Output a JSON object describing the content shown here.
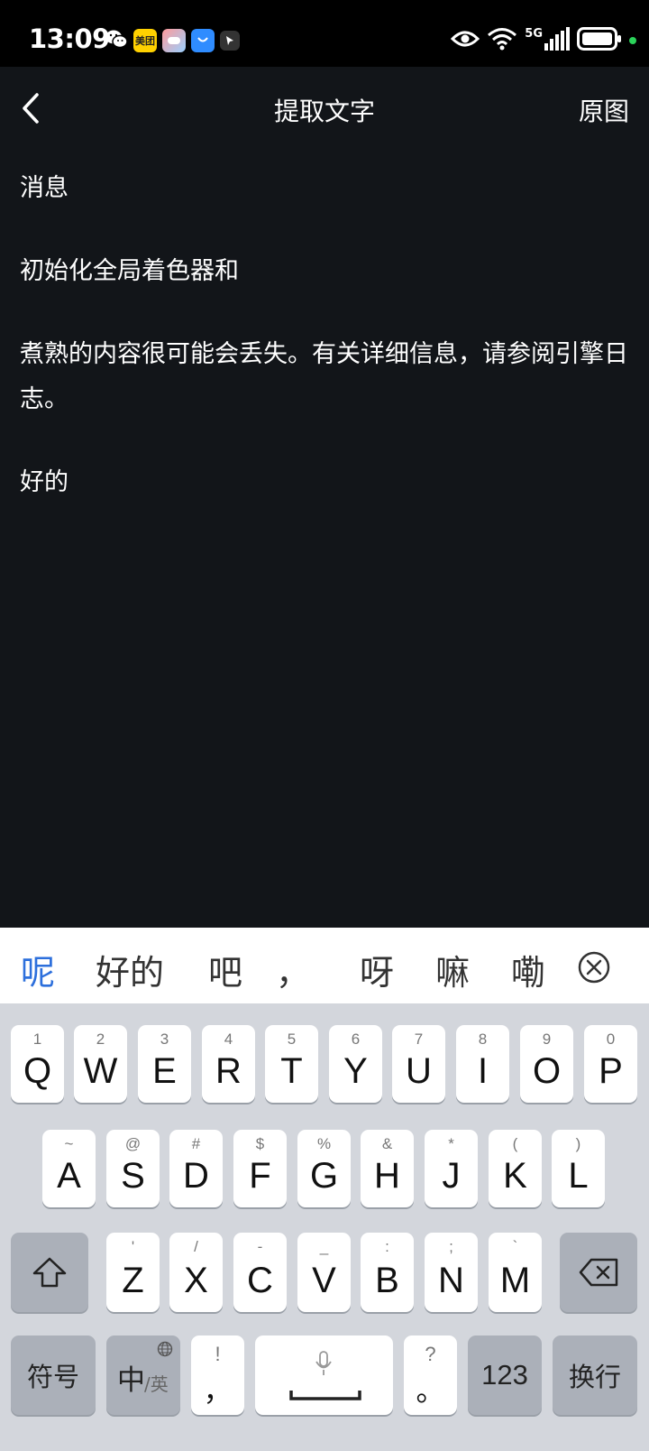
{
  "status_bar": {
    "time": "13:09",
    "apps": [
      {
        "name": "wechat-icon"
      },
      {
        "name": "meituan-icon",
        "label": "美团"
      },
      {
        "name": "game-center-icon"
      },
      {
        "name": "app-store-icon"
      },
      {
        "name": "pointer-app-icon"
      }
    ],
    "network": "5G",
    "colors": {
      "battery_dot": "#2bd35a"
    }
  },
  "header": {
    "title": "提取文字",
    "right_action": "原图"
  },
  "content": {
    "paragraphs": [
      "消息",
      "初始化全局着色器和",
      "煮熟的内容很可能会丢失。有关详细信息，请参阅引擎日志。",
      "好的"
    ]
  },
  "candidates": {
    "items": [
      "呢",
      "好的",
      "吧",
      "，",
      "呀",
      "嘛",
      "嘞"
    ],
    "accent": "#2c6fdc"
  },
  "keyboard": {
    "row1": [
      {
        "key": "Q",
        "sub": "1"
      },
      {
        "key": "W",
        "sub": "2"
      },
      {
        "key": "E",
        "sub": "3"
      },
      {
        "key": "R",
        "sub": "4"
      },
      {
        "key": "T",
        "sub": "5"
      },
      {
        "key": "Y",
        "sub": "6"
      },
      {
        "key": "U",
        "sub": "7"
      },
      {
        "key": "I",
        "sub": "8"
      },
      {
        "key": "O",
        "sub": "9"
      },
      {
        "key": "P",
        "sub": "0"
      }
    ],
    "row2": [
      {
        "key": "A",
        "sub": "~"
      },
      {
        "key": "S",
        "sub": "@"
      },
      {
        "key": "D",
        "sub": "#"
      },
      {
        "key": "F",
        "sub": "$"
      },
      {
        "key": "G",
        "sub": "%"
      },
      {
        "key": "H",
        "sub": "&"
      },
      {
        "key": "J",
        "sub": "*"
      },
      {
        "key": "K",
        "sub": "("
      },
      {
        "key": "L",
        "sub": ")"
      }
    ],
    "row3": [
      {
        "key": "Z",
        "sub": "'"
      },
      {
        "key": "X",
        "sub": "/"
      },
      {
        "key": "C",
        "sub": "-"
      },
      {
        "key": "V",
        "sub": "_"
      },
      {
        "key": "B",
        "sub": ":"
      },
      {
        "key": "N",
        "sub": ";"
      },
      {
        "key": "M",
        "sub": "`"
      }
    ],
    "symbols_label": "符号",
    "lang_main": "中",
    "lang_sub": "/英",
    "comma_main": "，",
    "comma_sub": "!",
    "period_main": "。",
    "period_sub": "?",
    "num_label": "123",
    "enter_label": "换行"
  }
}
